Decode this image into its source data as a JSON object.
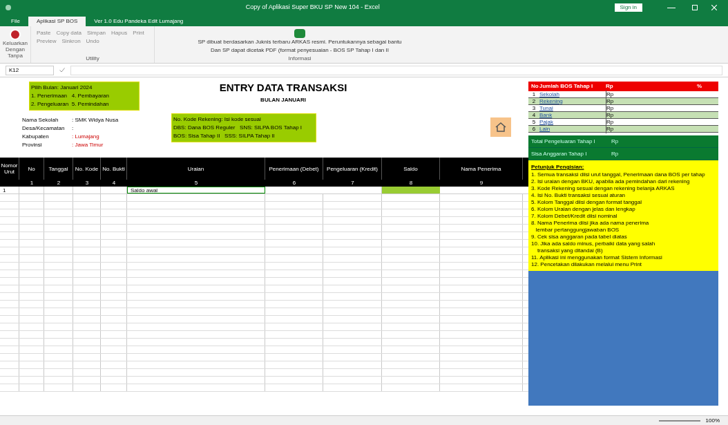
{
  "window": {
    "title": "Copy of Aplikasi Super BKU SP New 104 - Excel",
    "sign_in": "Sign in"
  },
  "ribbon_tabs": [
    {
      "label": "File",
      "selected": false
    },
    {
      "label": "Aplikasi SP BOS",
      "selected": true
    },
    {
      "label": "Ver 1.0 Edu Pandeka Edit Lumajang",
      "selected": false
    }
  ],
  "ribbon": {
    "exit_label": "Keluarkan Dengan Tanpa",
    "groups": [
      {
        "label": "Utility",
        "items": [
          "Paste",
          "Copy data",
          "Simpan",
          "Hapus",
          "Print",
          "Preview",
          "Sinkron",
          "Undo"
        ]
      }
    ],
    "info_lines": [
      "SP dibuat berdasarkan Juknis terbaru ARKAS resmi. Peruntukannya sebagai bantu",
      "Dan SP dapat dicetak PDF (format penyesuaian - BOS SP Tahap I dan II"
    ],
    "info_label": "Informasi"
  },
  "formula_bar": {
    "cell": "K12"
  },
  "sheet": {
    "title": "ENTRY DATA TRANSAKSI",
    "subtitle": "BULAN JANUARI",
    "note1": [
      "Pilih Bulan: Januari 2024",
      "1. Penerimaan   4. Pembayaran",
      "2. Pengeluaran  5. Pemindahan"
    ],
    "note2": [
      "No. Kode Rekening: Isi kode sesuai",
      "DBS: Dana BOS Reguler   SNS: SILPA BOS Tahap I",
      "BOS: Sisa Tahap II   SSS: SILPA Tahap II"
    ],
    "info": [
      {
        "label": "Nama Sekolah",
        "value": ": SMK Widya Nusa"
      },
      {
        "label": "Desa/Kecamatan",
        "value": ":"
      },
      {
        "label": "Kabupaten",
        "value": ": Lumajang"
      },
      {
        "label": "Provinsi",
        "value": ": Jawa Timur"
      }
    ],
    "columns": [
      "Nomor Urut",
      "No",
      "Tanggal",
      "No. Kode",
      "No. Bukti",
      "Uraian",
      "Penerimaan (Debet)",
      "Pengeluaran (Kredit)",
      "Saldo",
      "Nama Penerima"
    ],
    "column_numbers": [
      "1",
      "2",
      "3",
      "4",
      "5",
      "6",
      "7",
      "8",
      "9"
    ],
    "first_row": {
      "no": "1",
      "uraian": "Saldo awal"
    }
  },
  "summary": {
    "headers": [
      "No",
      "Jumlah BOS Tahap I",
      "Rp",
      "%"
    ],
    "rows": [
      {
        "no": "1",
        "name": "Sekolah",
        "value": "Rp"
      },
      {
        "no": "2",
        "name": "Rekening",
        "value": "Rp"
      },
      {
        "no": "3",
        "name": "Tunai",
        "value": "Rp"
      },
      {
        "no": "4",
        "name": "Bank",
        "value": "Rp"
      },
      {
        "no": "5",
        "name": "Pajak",
        "value": "Rp"
      },
      {
        "no": "6",
        "name": "Lain",
        "value": "Rp"
      }
    ],
    "totals": [
      {
        "label": "Total Pengeluaran Tahap I",
        "value": "Rp"
      },
      {
        "label": "Sisa Anggaran Tahap I",
        "value": "Rp"
      }
    ],
    "notes_title": "Petunjuk Pengisian:",
    "notes": [
      "1. Semua transaksi diisi urut tanggal, Penerimaan dana BOS per tahap",
      "2. Isi uraian dengan BKU, apabila ada pemindahan dari rekening",
      "3. Kode Rekening sesuai dengan rekening belanja ARKAS",
      "4. Isi No. Bukti transaksi sesuai aturan",
      "5. Kolom Tanggal diisi dengan format tanggal",
      "6. Kolom Uraian dengan jelas dan lengkap",
      "7. Kolom Debet/Kredit diisi nominal",
      "8. Nama Penerima diisi jika ada nama penerima",
      "   lembar pertanggungjawaban BOS",
      "9. Cek sisa anggaran pada tabel diatas",
      "10. Jika ada saldo minus, perbaiki data yang salah",
      "    transaksi yang ditandai (B)",
      "11. Aplikasi ini menggunakan format Sistem Informasi",
      "12. Pencetakan dilakukan melalui menu Print"
    ]
  },
  "status": {
    "zoom": "100%"
  }
}
